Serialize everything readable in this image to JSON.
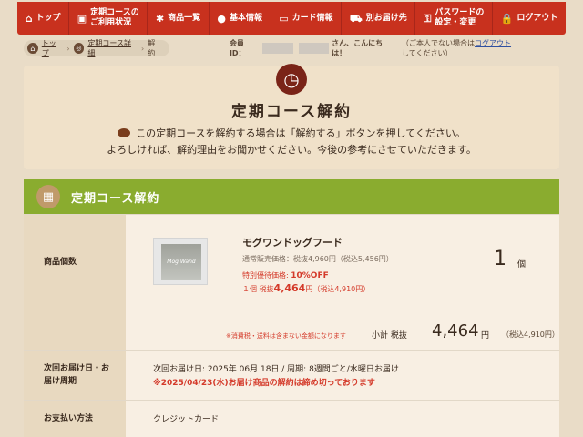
{
  "nav": [
    {
      "icon": "⌂",
      "label": "トップ"
    },
    {
      "icon": "▣",
      "label": "定期コースの\nご利用状況"
    },
    {
      "icon": "✱",
      "label": "商品一覧"
    },
    {
      "icon": "●",
      "label": "基本情報"
    },
    {
      "icon": "▭",
      "label": "カード情報"
    },
    {
      "icon": "⛟",
      "label": "別お届け先"
    },
    {
      "icon": "⚿",
      "label": "パスワードの\n設定・変更"
    },
    {
      "icon": "🔒",
      "label": "ログアウト"
    }
  ],
  "breadcrumb": {
    "home": "トップ",
    "course": "定期コース詳細",
    "current": "解約"
  },
  "member": {
    "label": "会員ID：",
    "greeting": "さん、こんにちは！",
    "note_prefix": "（ご本人でない場合は",
    "logout_link": "ログアウト",
    "note_suffix": "してください）"
  },
  "hero": {
    "title": "定期コース解約",
    "line1": "この定期コースを解約する場合は「解約する」ボタンを押してください。",
    "line2": "よろしければ、解約理由をお聞かせください。今後の参考にさせていただきます。"
  },
  "section": {
    "title": "定期コース解約"
  },
  "product_row": {
    "label": "商品個数",
    "thumb_text": "Mog Wand",
    "name": "モグワンドッグフード",
    "regular_price": "通常販売価格：税抜4,960円（税込5,456円）",
    "special_label": "特別優待価格:",
    "special_discount": "10%OFF",
    "unit_prefix": "１個 税抜",
    "unit_price": "4,464",
    "unit_suffix": "円（税込4,910円）",
    "quantity": "1",
    "quantity_unit": "個"
  },
  "subtotal": {
    "note": "※消費税・送料は含まない金額になります",
    "label": "小計 税抜",
    "value": "4,464",
    "yen": "円",
    "incl": "（税込4,910円）"
  },
  "delivery_row": {
    "label": "次回お届け日・お\n届け周期",
    "line1": "次回お届け日: 2025年 06月 18日 / 周期: 8週間ごと/水曜日お届け",
    "line2": "※2025/04/23(水)お届け商品の解約は締め切っております"
  },
  "payment_row": {
    "label": "お支払い方法",
    "value": "クレジットカード"
  },
  "colors": {
    "nav_bg": "#c8311e",
    "section_green": "#8aac2f",
    "accent_red": "#d43a2a",
    "clock_badge": "#7a2418"
  }
}
